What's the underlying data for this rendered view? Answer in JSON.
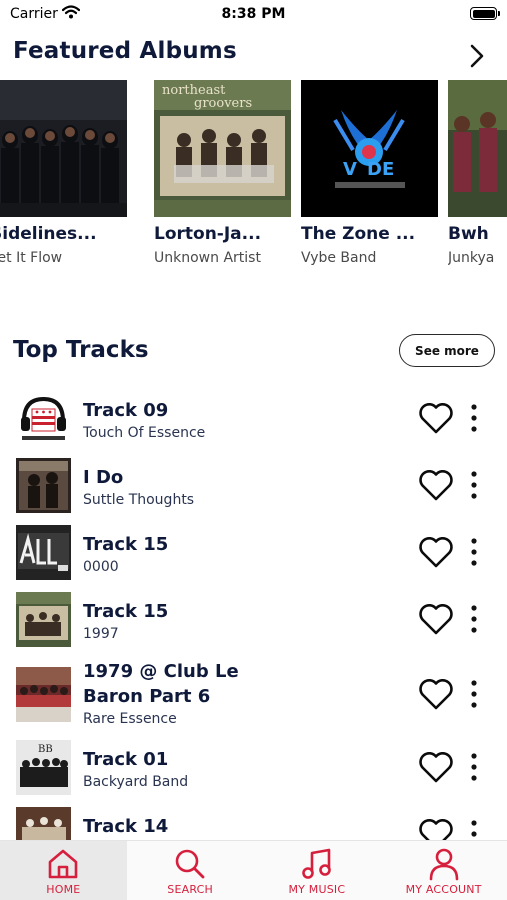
{
  "status_bar": {
    "carrier": "Carrier",
    "time": "8:38 PM"
  },
  "featured": {
    "title": "Featured Albums",
    "albums": [
      {
        "title": "Sidelines...",
        "artist": "Let It Flow"
      },
      {
        "title": "Lorton-Ja...",
        "artist": "Unknown Artist"
      },
      {
        "title": "The Zone ...",
        "artist": "Vybe Band"
      },
      {
        "title": "Bwh",
        "artist": "Junkya"
      }
    ]
  },
  "top_tracks": {
    "title": "Top Tracks",
    "see_more_label": "See more",
    "tracks": [
      {
        "title": "Track 09",
        "artist": "Touch Of Essence"
      },
      {
        "title": "I Do",
        "artist": "Suttle Thoughts"
      },
      {
        "title": "Track 15",
        "artist": "0000"
      },
      {
        "title": "Track 15",
        "artist": "1997"
      },
      {
        "title": "1979 @ Club Le Baron Part 6",
        "artist": "Rare Essence"
      },
      {
        "title": "Track 01",
        "artist": "Backyard Band"
      },
      {
        "title": "Track 14",
        "artist": ""
      }
    ]
  },
  "tab_bar": {
    "active": "home",
    "tabs": [
      {
        "id": "home",
        "label": "HOME",
        "icon": "home-icon"
      },
      {
        "id": "search",
        "label": "SEARCH",
        "icon": "search-icon"
      },
      {
        "id": "my_music",
        "label": "MY MUSIC",
        "icon": "music-note-icon"
      },
      {
        "id": "my_account",
        "label": "MY ACCOUNT",
        "icon": "user-icon"
      }
    ]
  },
  "colors": {
    "accent": "#d61f3c",
    "text_dark": "#0f1a3a",
    "tab_active_bg": "#e9e9e9"
  }
}
